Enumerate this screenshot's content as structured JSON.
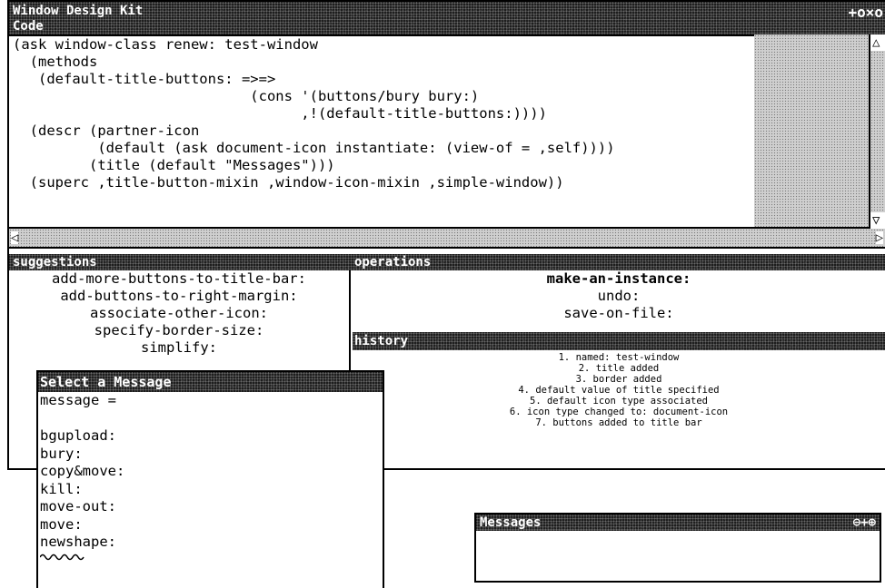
{
  "main_window": {
    "title": "Window Design Kit",
    "subtitle": "Code",
    "title_buttons": "+o×o"
  },
  "code": {
    "lines": [
      "(ask window-class renew: test-window",
      "  (methods",
      "   (default-title-buttons: =>=>",
      "                            (cons '(buttons/bury bury:)",
      "                                  ,!(default-title-buttons:))))",
      "  (descr (partner-icon",
      "          (default (ask document-icon instantiate: (view-of = ,self))))",
      "         (title (default \"Messages\")))",
      "  (superc ,title-button-mixin ,window-icon-mixin ,simple-window))"
    ]
  },
  "suggestions": {
    "title": "suggestions",
    "items": [
      "add-more-buttons-to-title-bar:",
      "add-buttons-to-right-margin:",
      "associate-other-icon:",
      "specify-border-size:",
      "simplify:"
    ]
  },
  "operations": {
    "title": "operations",
    "items": [
      "make-an-instance:",
      "undo:",
      "save-on-file:"
    ]
  },
  "history": {
    "title": "history",
    "items": [
      "1. named: test-window",
      "2. title added",
      "3. border added",
      "4. default value of title specified",
      "5. default icon type associated",
      "6. icon type changed to: document-icon",
      "7. buttons added to title bar"
    ]
  },
  "select_message": {
    "title": "Select a Message",
    "items": [
      "message =",
      "",
      "bgupload:",
      "bury:",
      "copy&move:",
      "kill:",
      "move-out:",
      "move:",
      "newshape:"
    ]
  },
  "messages_window": {
    "title": "Messages",
    "title_buttons": "⊖+⊕"
  }
}
